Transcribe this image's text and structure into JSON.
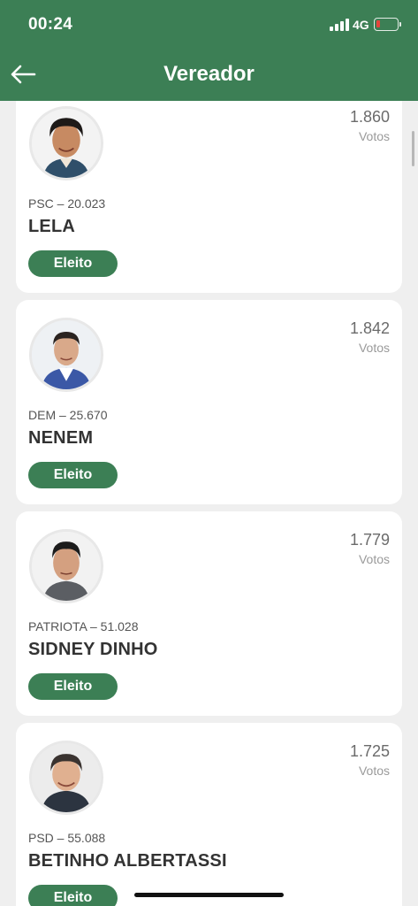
{
  "status_bar": {
    "time": "00:24",
    "network": "4G"
  },
  "header": {
    "title": "Vereador"
  },
  "candidates": [
    {
      "party": "PSC – 20.023",
      "name": "LELA",
      "votes": "1.860",
      "votes_label": "Votos",
      "status": "Eleito"
    },
    {
      "party": "DEM – 25.670",
      "name": "NENEM",
      "votes": "1.842",
      "votes_label": "Votos",
      "status": "Eleito"
    },
    {
      "party": "PATRIOTA – 51.028",
      "name": "SIDNEY DINHO",
      "votes": "1.779",
      "votes_label": "Votos",
      "status": "Eleito"
    },
    {
      "party": "PSD – 55.088",
      "name": "BETINHO ALBERTASSI",
      "votes": "1.725",
      "votes_label": "Votos",
      "status": "Eleito"
    }
  ],
  "colors": {
    "brand": "#3c7f55",
    "background": "#efefef",
    "card": "#ffffff"
  }
}
